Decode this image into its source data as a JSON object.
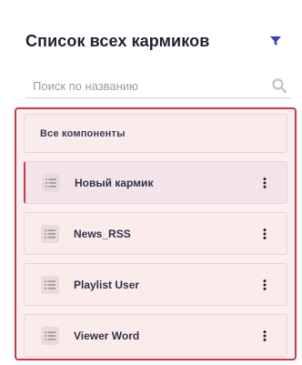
{
  "header": {
    "title": "Список всех кармиков",
    "filter_icon": "filter-icon",
    "accent_color": "#3b3fb5"
  },
  "search": {
    "placeholder": "Поиск по названию",
    "value": "",
    "icon": "search-icon"
  },
  "list": {
    "border_color": "#c9394a",
    "all_label": "Все компоненты",
    "items": [
      {
        "label": "Новый кармик",
        "active": true,
        "handle_icon": "drag-handle-icon",
        "menu_icon": "more-vertical-icon"
      },
      {
        "label": "News_RSS",
        "active": false,
        "handle_icon": "drag-handle-icon",
        "menu_icon": "more-vertical-icon"
      },
      {
        "label": "Playlist User",
        "active": false,
        "handle_icon": "drag-handle-icon",
        "menu_icon": "more-vertical-icon"
      },
      {
        "label": "Viewer Word",
        "active": false,
        "handle_icon": "drag-handle-icon",
        "menu_icon": "more-vertical-icon"
      }
    ]
  }
}
